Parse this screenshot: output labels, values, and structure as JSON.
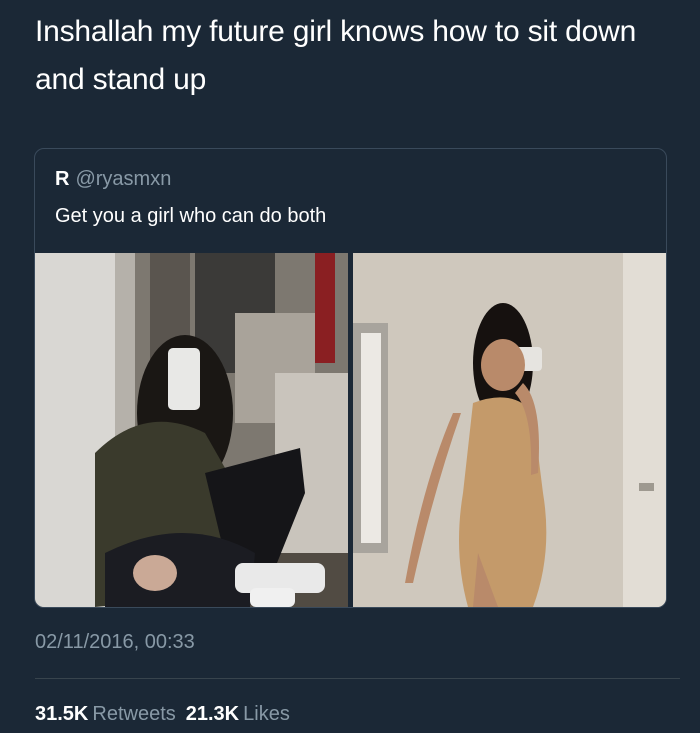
{
  "tweet": {
    "text": "Inshallah my future girl knows how to sit down and stand up",
    "timestamp": "02/11/2016, 00:33"
  },
  "quoted_tweet": {
    "name": "R",
    "handle": "@ryasmxn",
    "text": "Get you a girl who can do both"
  },
  "stats": {
    "retweets_count": "31.5K",
    "retweets_label": "Retweets",
    "likes_count": "21.3K",
    "likes_label": "Likes"
  },
  "colors": {
    "background": "#1b2836",
    "primary_text": "#ffffff",
    "secondary_text": "#8899a6",
    "border": "#3a4a5b"
  }
}
